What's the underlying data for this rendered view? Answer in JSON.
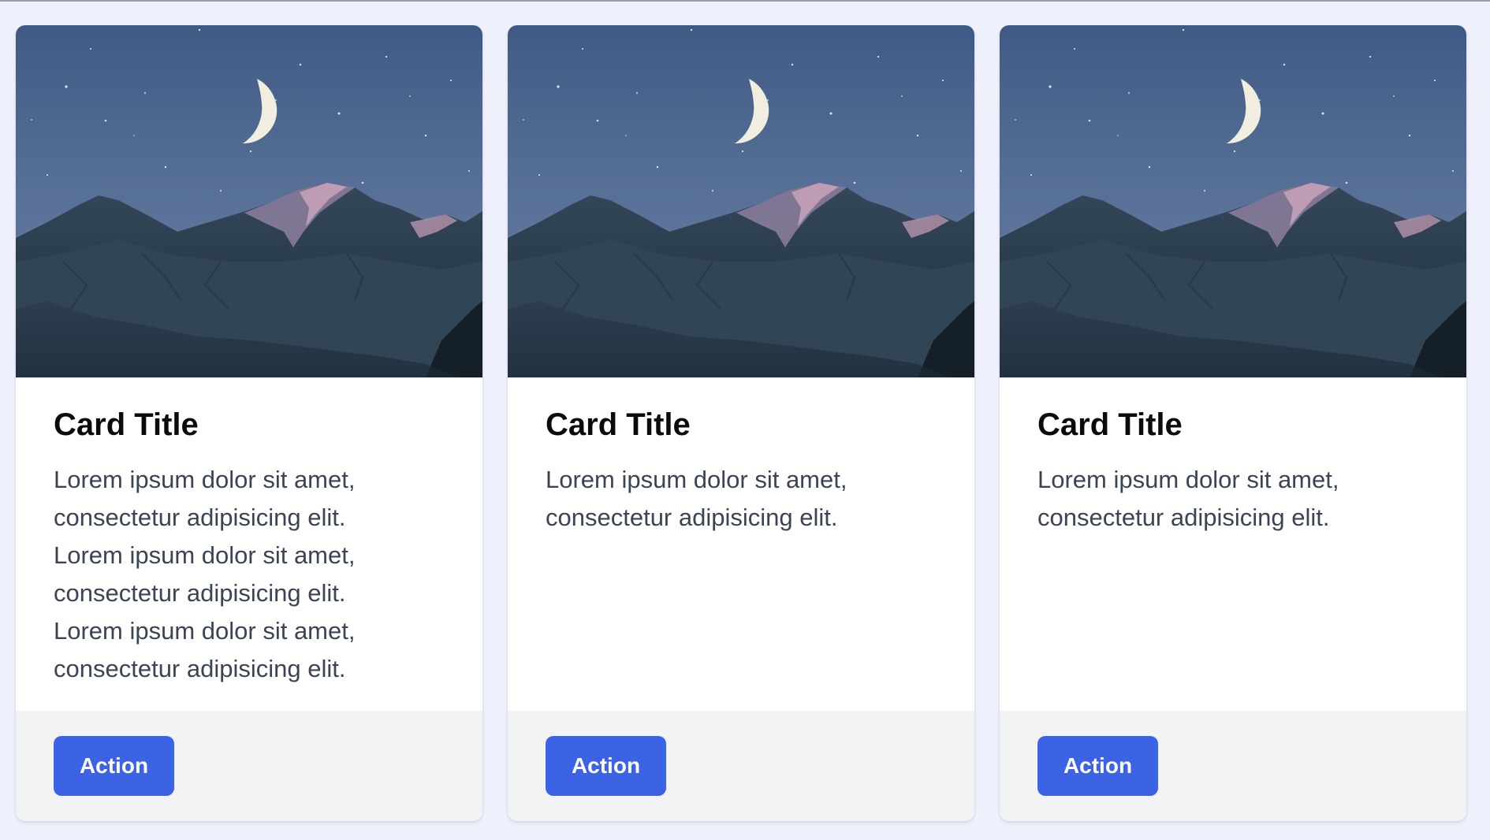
{
  "cards": [
    {
      "image_subject": "crescent moon over snowy mountains at night",
      "title": "Card Title",
      "text": "Lorem ipsum dolor sit amet,\nconsectetur adipisicing elit.\nLorem ipsum dolor sit amet,\nconsectetur adipisicing elit.\nLorem ipsum dolor sit amet,\nconsectetur adipisicing elit.",
      "action_label": "Action"
    },
    {
      "image_subject": "crescent moon over snowy mountains at night",
      "title": "Card Title",
      "text": "Lorem ipsum dolor sit amet,\nconsectetur adipisicing elit.",
      "action_label": "Action"
    },
    {
      "image_subject": "crescent moon over snowy mountains at night",
      "title": "Card Title",
      "text": "Lorem ipsum dolor sit amet,\nconsectetur adipisicing elit.",
      "action_label": "Action"
    }
  ],
  "colors": {
    "page_background": "#eef0fb",
    "card_background": "#ffffff",
    "footer_background": "#f2f3f5",
    "button_background": "#3b63e4",
    "button_text": "#ffffff",
    "title_text": "#0b0b0b",
    "body_text": "#3a4456"
  }
}
